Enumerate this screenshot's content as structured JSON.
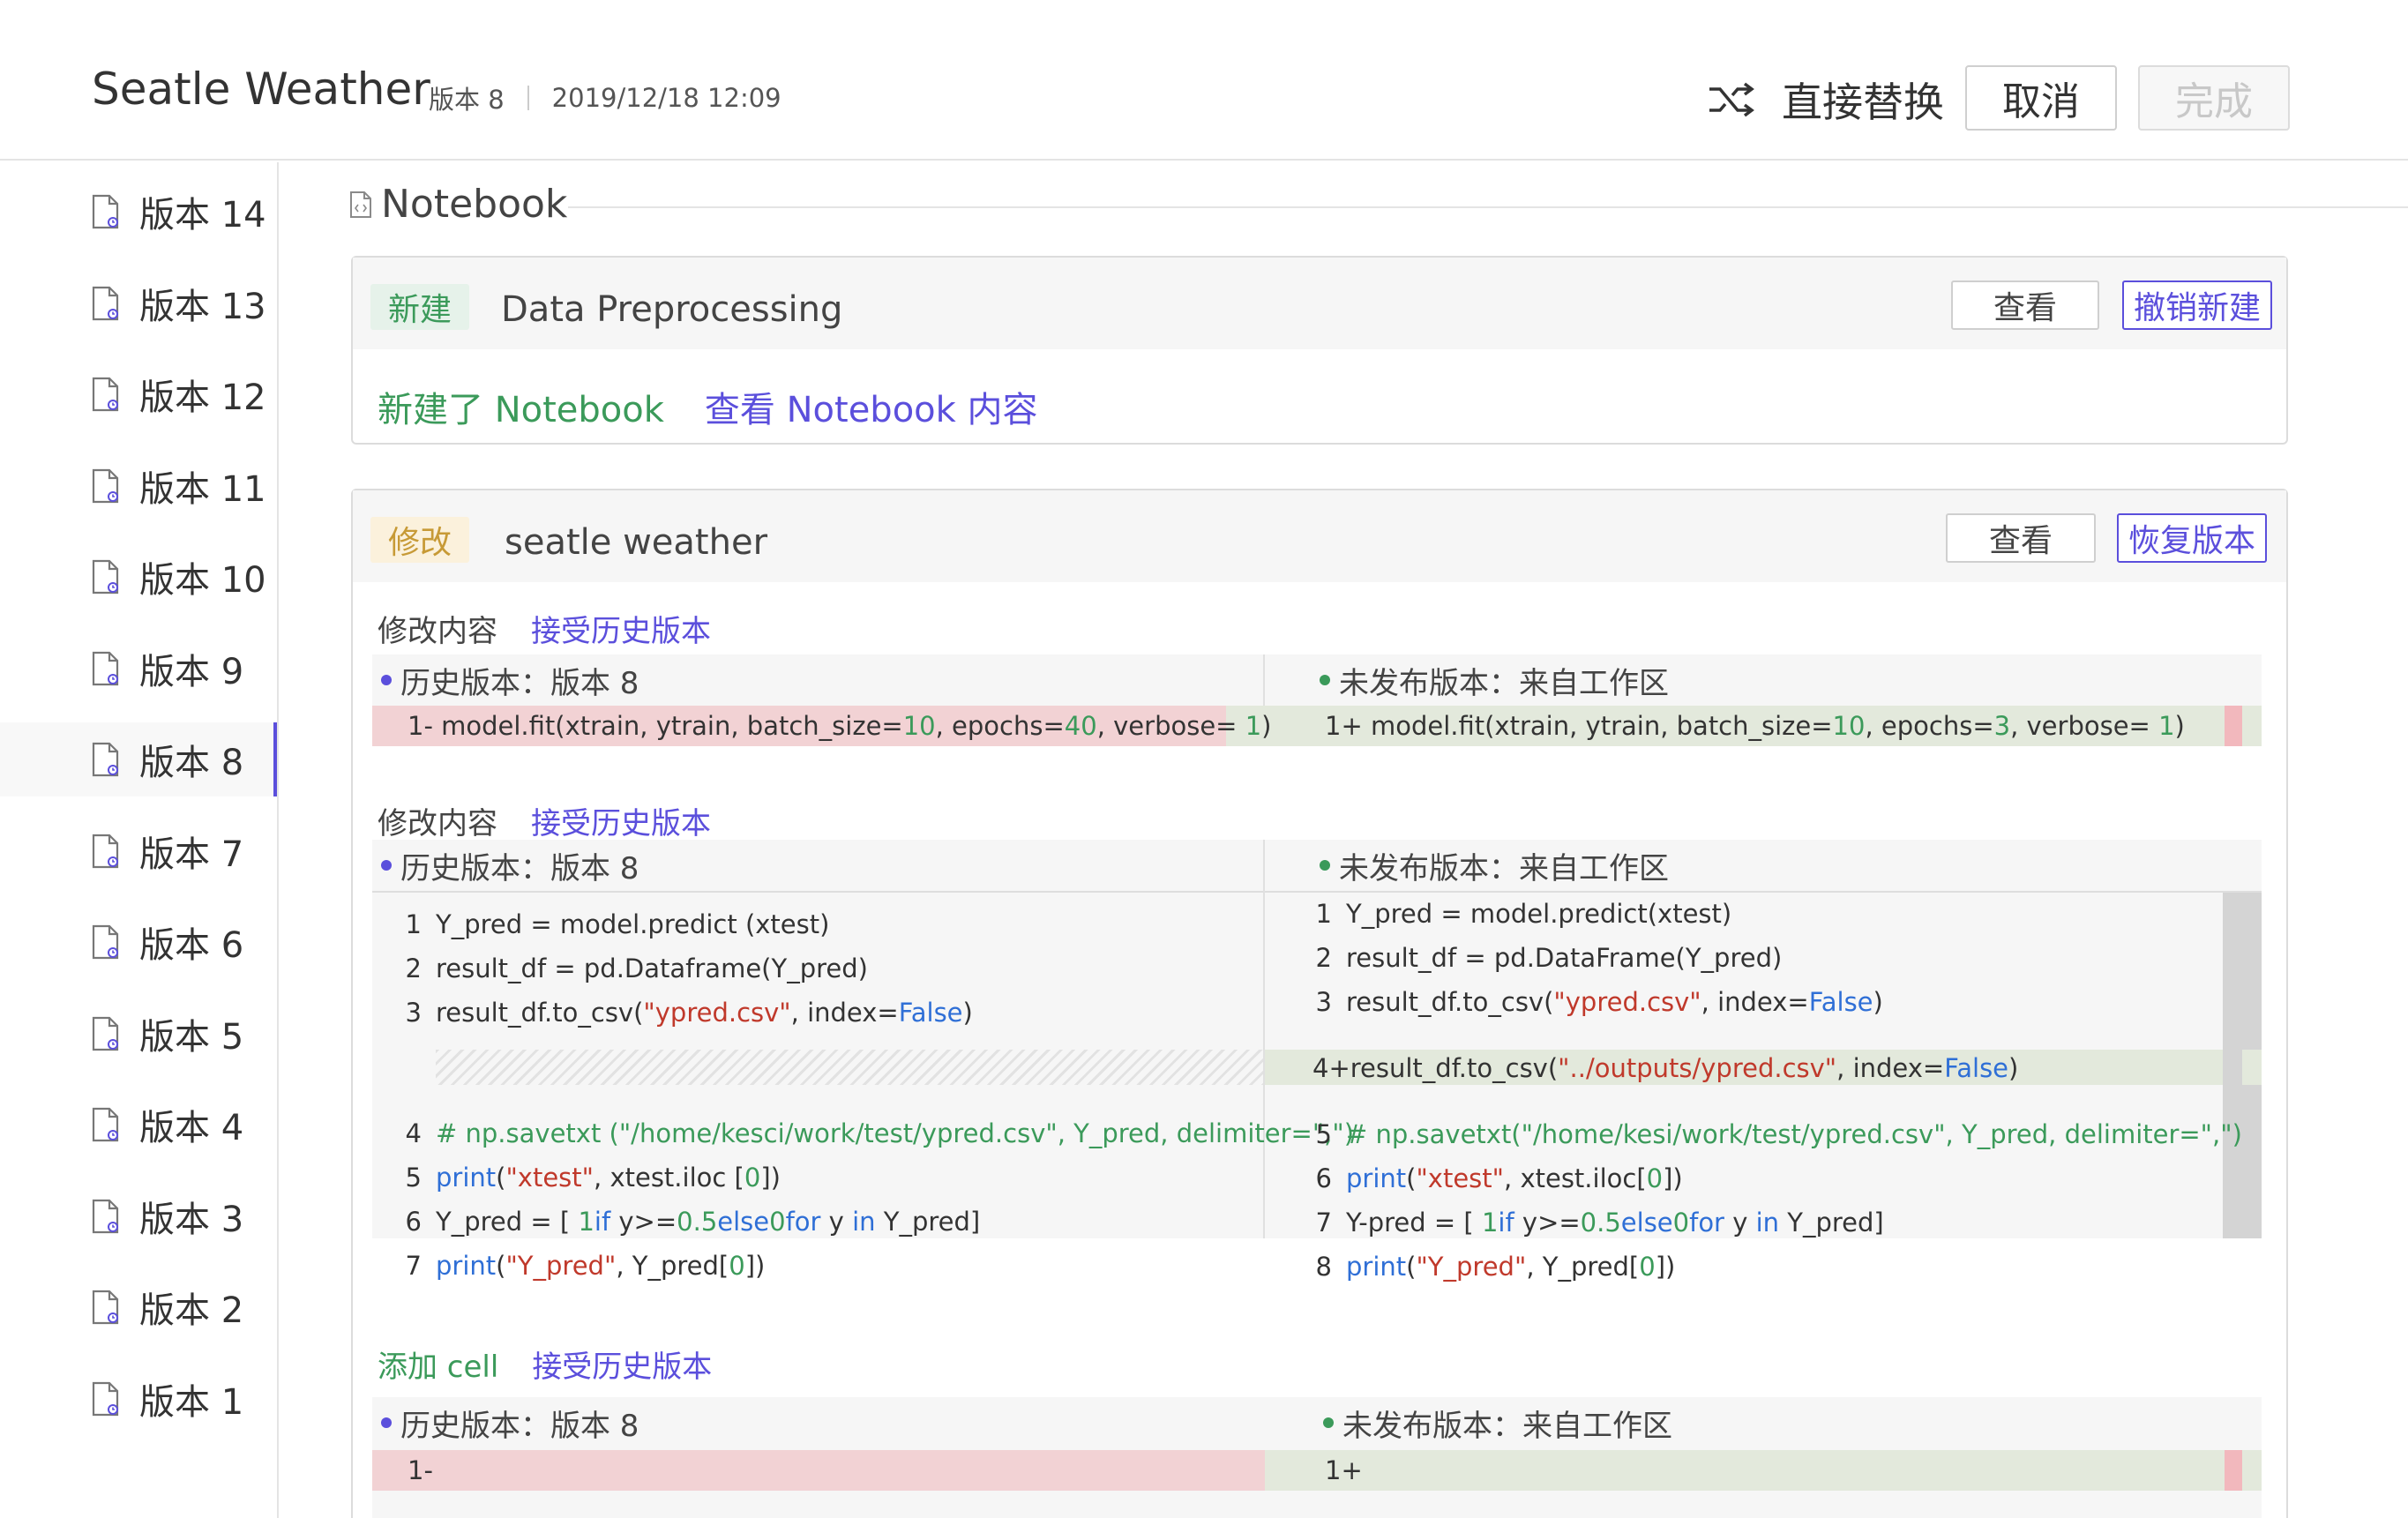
{
  "header": {
    "title": "Seatle Weather",
    "version": "版本 8",
    "datetime": "2019/12/18 12:09",
    "replace_label": "直接替换",
    "cancel_label": "取消",
    "done_label": "完成"
  },
  "sidebar": {
    "items": [
      "版本 14",
      "版本 13",
      "版本 12",
      "版本 11",
      "版本 10",
      "版本 9",
      "版本 8",
      "版本 7",
      "版本 6",
      "版本 5",
      "版本 4",
      "版本 3",
      "版本 2",
      "版本 1"
    ],
    "active_index": 6
  },
  "section": {
    "title": "Notebook"
  },
  "card1": {
    "badge": "新建",
    "name": "Data Preprocessing",
    "view_label": "查看",
    "action_label": "撤销新建",
    "summary_created": "新建了 Notebook",
    "summary_view": "查看 Notebook 内容"
  },
  "card2": {
    "badge": "修改",
    "name": "seatle weather",
    "view_label": "查看",
    "action_label": "恢复版本",
    "blocks": [
      {
        "type_label": "修改内容",
        "accept_label": "接受历史版本",
        "left_header": "历史版本：版本 8",
        "right_header": "未发布版本：来自工作区",
        "left_line": "1- model.fit(xtrain, ytrain, batch_size=10, epochs=40, verbose= 1)",
        "right_line": "1+model.fit(xtrain, ytrain, batch_size=10, epochs=3, verbose= 1)"
      },
      {
        "type_label": "修改内容",
        "accept_label": "接受历史版本",
        "left_header": "历史版本：版本 8",
        "right_header": "未发布版本：来自工作区",
        "left_lines": [
          {
            "n": "1",
            "code": "Y_pred = model.predict (xtest)"
          },
          {
            "n": "2",
            "code": "result_df = pd.Dataframe(Y_pred)"
          },
          {
            "n": "3",
            "code": "result_df.to_csv(\"ypred.csv\", index=False)"
          },
          {
            "n": "4",
            "code": "# np.savetxt (\"/home/kesci/work/test/ypred.csv\", Y_pred, delimiter=\",\")"
          },
          {
            "n": "5",
            "code": "print(\"xtest\", xtest.iloc [0])"
          },
          {
            "n": "6",
            "code": "Y_pred = [ 1 if y>=0.5 else 0 for y in Y_pred]"
          },
          {
            "n": "7",
            "code": "print(\"Y_pred\", Y_pred[0])"
          }
        ],
        "right_lines": [
          {
            "n": "1",
            "code": "Y_pred = model.predict(xtest)"
          },
          {
            "n": "2",
            "code": "result_df = pd.DataFrame(Y_pred)"
          },
          {
            "n": "3",
            "code": "result_df.to_csv(\"ypred.csv\", index=False)"
          },
          {
            "n": "4+",
            "code": "result_df.to_csv(\"../outputs/ypred.csv\", index=False)"
          },
          {
            "n": "5",
            "code": "# np.savetxt(\"/home/kesi/work/test/ypred.csv\", Y_pred, delimiter=\",\")"
          },
          {
            "n": "6",
            "code": "print(\"xtest\", xtest.iloc[0])"
          },
          {
            "n": "7",
            "code": "Y-pred = [ 1 if y>=0.5 else 0 for y in Y_pred]"
          },
          {
            "n": "8",
            "code": "print(\"Y_pred\", Y_pred[0])"
          }
        ]
      },
      {
        "type_label": "添加 cell",
        "accept_label": "接受历史版本",
        "left_header": "历史版本：版本 8",
        "right_header": "未发布版本：来自工作区",
        "left_line": "1-",
        "right_line": "1+"
      }
    ]
  },
  "colors": {
    "accent": "#5b4fdc",
    "added_green": "#3b9a5a",
    "deleted_bg": "#f2d2d4",
    "added_bg": "#e3e9dc"
  }
}
